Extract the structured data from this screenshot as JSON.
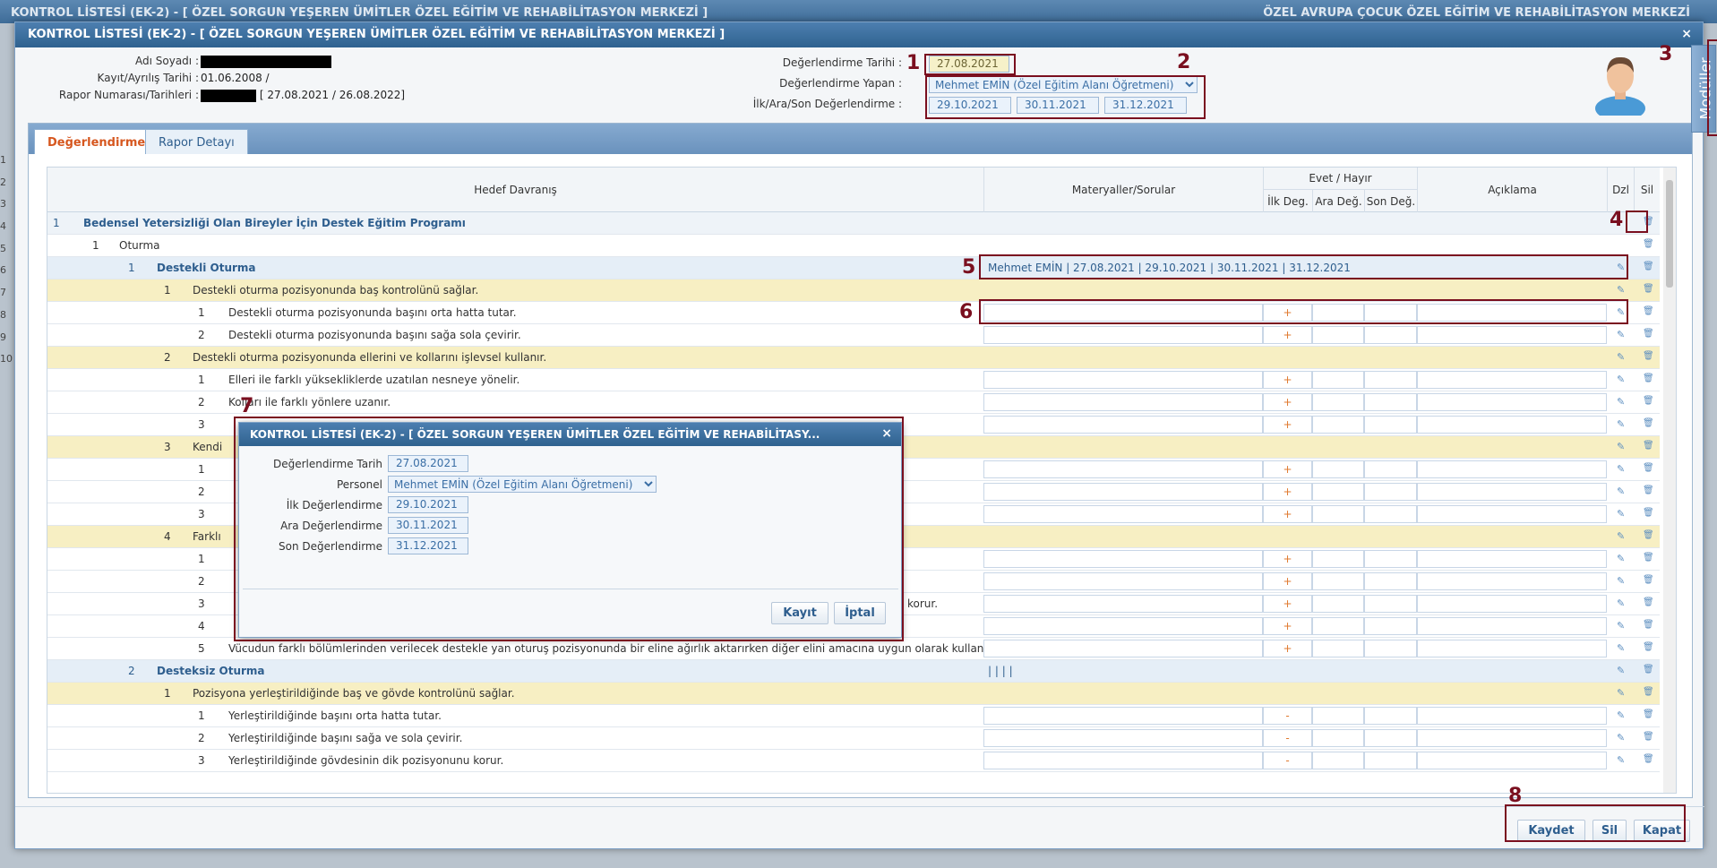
{
  "background": {
    "title": "KONTROL LİSTESİ (EK-2) - [ ÖZEL SORGUN YEŞEREN ÜMİTLER ÖZEL EĞİTİM VE REHABİLİTASYON MERKEZİ ]",
    "right": "ÖZEL AVRUPA ÇOCUK ÖZEL EĞİTİM VE REHABİLİTASYON MERKEZİ",
    "row_numbers": [
      "1",
      "2",
      "3",
      "4",
      "5",
      "6",
      "7",
      "8",
      "9",
      "10"
    ]
  },
  "window": {
    "title": "KONTROL LİSTESİ (EK-2) - [ ÖZEL SORGUN YEŞEREN ÜMİTLER ÖZEL EĞİTİM VE REHABİLİTASYON MERKEZİ ]",
    "close": "×"
  },
  "info": {
    "name_label": "Adı Soyadı :",
    "kayit_label": "Kayıt/Ayrılış Tarihi :",
    "kayit_value": "01.06.2008 /",
    "rapor_label": "Rapor Numarası/Tarihleri :",
    "rapor_value": "[ 27.08.2021 / 26.08.2022]",
    "deg_tarih_label": "Değerlendirme Tarihi :",
    "deg_tarih": "27.08.2021",
    "deg_yapan_label": "Değerlendirme Yapan :",
    "deg_yapan": "Mehmet EMİN (Özel Eğitim Alanı Öğretmeni)",
    "ilk_label": "İlk/Ara/Son Değerlendirme :",
    "dates": [
      "29.10.2021",
      "30.11.2021",
      "31.12.2021"
    ]
  },
  "modules": "Modüller",
  "tabs": [
    "Değerlendirme",
    "Rapor Detayı"
  ],
  "grid": {
    "headers": {
      "hedef": "Hedef Davranış",
      "materyal": "Materyaller/Sorular",
      "evet": "Evet / Hayır",
      "ilk": "İlk Deg.",
      "ara": "Ara Değ.",
      "son": "Son Değ.",
      "aciklama": "Açıklama",
      "dzl": "Dzl",
      "sil": "Sil"
    },
    "rows": [
      {
        "lvl": 1,
        "n": "1",
        "t": "Bedensel Yetersizliği Olan Bireyler İçin Destek Eğitim Programı"
      },
      {
        "lvl": 2,
        "n": "1",
        "t": "Oturma"
      },
      {
        "lvl": 3,
        "n": "1",
        "t": "Destekli Oturma",
        "info": "Mehmet EMİN | 27.08.2021 | 29.10.2021 | 30.11.2021 | 31.12.2021"
      },
      {
        "lvl": 4,
        "n": "1",
        "t": "Destekli oturma pozisyonunda baş kontrolünü sağlar."
      },
      {
        "lvl": 5,
        "n": "1",
        "t": "Destekli oturma pozisyonunda başını orta hatta tutar.",
        "m": "+"
      },
      {
        "lvl": 5,
        "n": "2",
        "t": "Destekli oturma pozisyonunda başını sağa sola çevirir.",
        "m": "+"
      },
      {
        "lvl": 4,
        "n": "2",
        "t": "Destekli oturma pozisyonunda ellerini ve kollarını işlevsel kullanır."
      },
      {
        "lvl": 5,
        "n": "1",
        "t": "Elleri ile farklı yüksekliklerde uzatılan nesneye yönelir.",
        "m": "+"
      },
      {
        "lvl": 5,
        "n": "2",
        "t": "Kolları ile farklı yönlere uzanır.",
        "m": "+"
      },
      {
        "lvl": 5,
        "n": "3",
        "t": "",
        "m": "+"
      },
      {
        "lvl": 4,
        "n": "3",
        "t": "Kendi"
      },
      {
        "lvl": 5,
        "n": "1",
        "t": "",
        "m": "+"
      },
      {
        "lvl": 5,
        "n": "2",
        "t": "",
        "m": "+"
      },
      {
        "lvl": 5,
        "n": "3",
        "t": "",
        "m": "+"
      },
      {
        "lvl": 4,
        "n": "4",
        "t": "Farklı"
      },
      {
        "lvl": 5,
        "n": "1",
        "t": "",
        "m": "+"
      },
      {
        "lvl": 5,
        "n": "2",
        "t": "",
        "m": "+"
      },
      {
        "lvl": 5,
        "n": "3",
        "t": "korur.",
        "m": "+",
        "right": true
      },
      {
        "lvl": 5,
        "n": "4",
        "t": "",
        "m": "+"
      },
      {
        "lvl": 5,
        "n": "5",
        "t": "Vücudun farklı bölümlerinden verilecek destekle yan oturuş pozisyonunda bir eline ağırlık aktarırken diğer elini amacına uygun olarak kullanır.",
        "m": "+"
      },
      {
        "lvl": 3,
        "n": "2",
        "t": "Desteksiz Oturma",
        "info": "| | | |"
      },
      {
        "lvl": 4,
        "n": "1",
        "t": "Pozisyona yerleştirildiğinde baş ve gövde kontrolünü sağlar."
      },
      {
        "lvl": 5,
        "n": "1",
        "t": "Yerleştirildiğinde başını orta hatta tutar.",
        "m": "-"
      },
      {
        "lvl": 5,
        "n": "2",
        "t": "Yerleştirildiğinde başını sağa ve sola çevirir.",
        "m": "-"
      },
      {
        "lvl": 5,
        "n": "3",
        "t": "Yerleştirildiğinde gövdesinin dik pozisyonunu korur.",
        "m": "-"
      }
    ]
  },
  "dialog": {
    "title": "KONTROL LİSTESİ (EK-2) - [ ÖZEL SORGUN YEŞEREN ÜMİTLER ÖZEL EĞİTİM VE REHABİLİTASY...",
    "close": "×",
    "tarih_label": "Değerlendirme Tarih",
    "tarih": "27.08.2021",
    "personel_label": "Personel",
    "personel": "Mehmet EMİN (Özel Eğitim Alanı Öğretmeni)",
    "ilk_label": "İlk Değerlendirme",
    "ilk": "29.10.2021",
    "ara_label": "Ara Değerlendirme",
    "ara": "30.11.2021",
    "son_label": "Son Değerlendirme",
    "son": "31.12.2021",
    "kayit": "Kayıt",
    "iptal": "İptal"
  },
  "footer": {
    "kaydet": "Kaydet",
    "sil": "Sil",
    "kapat": "Kapat"
  },
  "annotations": [
    "1",
    "2",
    "3",
    "4",
    "5",
    "6",
    "7",
    "8"
  ],
  "colors": {
    "annotation": "#7a0f1f",
    "accent": "#3a6ea5",
    "active_tab": "#d6571f",
    "yellow_row": "#f7efc3"
  }
}
